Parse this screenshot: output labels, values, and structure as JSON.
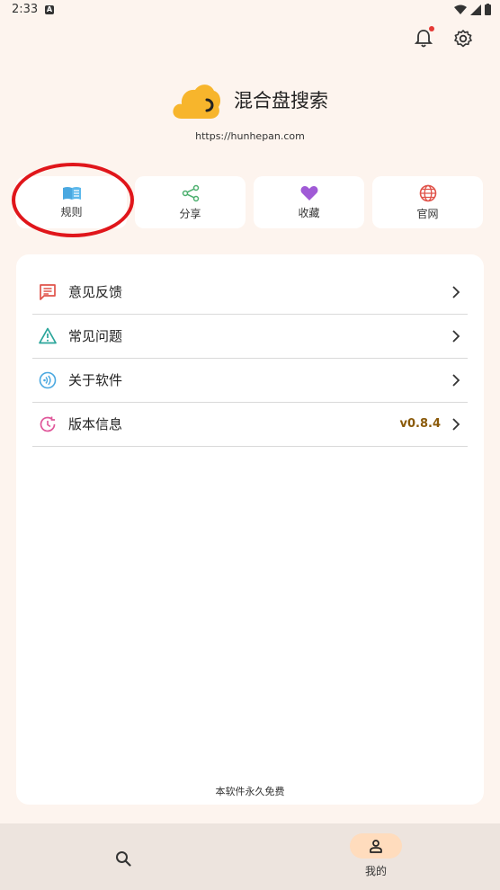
{
  "status_bar": {
    "time": "2:33",
    "notification_icon": "A"
  },
  "header": {
    "bell_icon": "bell-icon",
    "settings_icon": "gear-icon",
    "has_notification": true
  },
  "app": {
    "name": "混合盘搜索",
    "url": "https://hunhepan.com",
    "logo_color": "#f7b52c"
  },
  "quick_actions": [
    {
      "label": "规则",
      "icon": "book-icon",
      "color": "#4aa8e0"
    },
    {
      "label": "分享",
      "icon": "share-icon",
      "color": "#4caf6e"
    },
    {
      "label": "收藏",
      "icon": "heart-icon",
      "color": "#a05ad6"
    },
    {
      "label": "官网",
      "icon": "globe-icon",
      "color": "#e0534a"
    }
  ],
  "menu": [
    {
      "label": "意见反馈",
      "icon": "feedback-icon",
      "color": "#e0534a",
      "value": ""
    },
    {
      "label": "常见问题",
      "icon": "warning-icon",
      "color": "#2aa59a",
      "value": ""
    },
    {
      "label": "关于软件",
      "icon": "info-icon",
      "color": "#4aa8e0",
      "value": ""
    },
    {
      "label": "版本信息",
      "icon": "history-icon",
      "color": "#e0579a",
      "value": "v0.8.4"
    }
  ],
  "footer_note": "本软件永久免费",
  "bottom_nav": {
    "search_icon": "search-icon",
    "me_label": "我的",
    "me_icon": "person-icon"
  },
  "colors": {
    "background": "#fdf4ee",
    "highlight": "#e0161b",
    "active_pill": "#ffdcbd"
  }
}
